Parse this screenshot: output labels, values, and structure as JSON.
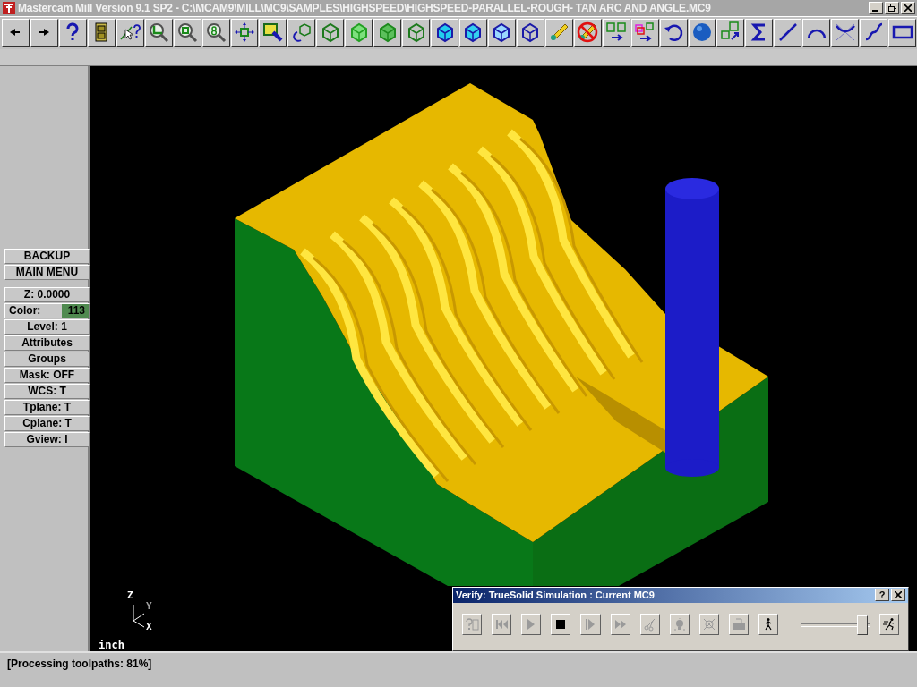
{
  "window": {
    "title": "Mastercam Mill Version 9.1 SP2 - C:\\MCAM9\\MILL\\MC9\\SAMPLES\\HIGHSPEED\\HIGHSPEED-PARALLEL-ROUGH- TAN ARC AND ANGLE.MC9"
  },
  "toolbar": [
    {
      "kind": "left-arrow"
    },
    {
      "kind": "right-arrow"
    },
    {
      "kind": "question-mark"
    },
    {
      "kind": "cabinet"
    },
    {
      "kind": "cursor-question"
    },
    {
      "kind": "magnifier-corner"
    },
    {
      "kind": "magnifier-square"
    },
    {
      "kind": "magnifier-eight"
    },
    {
      "kind": "move-arrows"
    },
    {
      "kind": "paint-brush"
    },
    {
      "kind": "rotate-cube"
    },
    {
      "kind": "wire-cube"
    },
    {
      "kind": "light-cube"
    },
    {
      "kind": "shaded-cube"
    },
    {
      "kind": "hidden-cube"
    },
    {
      "kind": "solid-cube"
    },
    {
      "kind": "face-cube"
    },
    {
      "kind": "side-cube"
    },
    {
      "kind": "outline-cube"
    },
    {
      "kind": "pencil"
    },
    {
      "kind": "no-pencil"
    },
    {
      "kind": "squares-arrow"
    },
    {
      "kind": "colored-squares"
    },
    {
      "kind": "undo-arrow"
    },
    {
      "kind": "sphere"
    },
    {
      "kind": "cubes-arrow"
    },
    {
      "kind": "sigma"
    },
    {
      "kind": "line"
    },
    {
      "kind": "arc"
    },
    {
      "kind": "fillet"
    },
    {
      "kind": "spline"
    },
    {
      "kind": "rectangle"
    }
  ],
  "menu": [
    "BACKUP",
    "MAIN MENU"
  ],
  "settings": [
    {
      "label": "Z:  0.0000"
    },
    {
      "label": "Color:",
      "value": "113",
      "color": "#4f8a4f"
    },
    {
      "label": "Level:  1"
    },
    {
      "label": "Attributes"
    },
    {
      "label": "Groups"
    },
    {
      "label": "Mask:  OFF"
    },
    {
      "label": "WCS:  T"
    },
    {
      "label": "Tplane:  T"
    },
    {
      "label": "Cplane:  T"
    },
    {
      "label": "Gview:  I"
    }
  ],
  "viewport": {
    "axes": {
      "z": "Z",
      "y": "Y",
      "x": "X"
    },
    "units": "inch"
  },
  "verify_dialog": {
    "title": "Verify: TrueSolid Simulation : Current MC9",
    "help": "?",
    "buttons": [
      {
        "kind": "file-help",
        "disabled": true
      },
      {
        "kind": "rewind",
        "disabled": true
      },
      {
        "kind": "play",
        "disabled": true
      },
      {
        "kind": "stop",
        "disabled": false
      },
      {
        "kind": "step",
        "disabled": true
      },
      {
        "kind": "fast-forward",
        "disabled": true
      },
      {
        "kind": "scissors",
        "disabled": true
      },
      {
        "kind": "bulb",
        "disabled": true
      },
      {
        "kind": "crossed-target",
        "disabled": true
      },
      {
        "kind": "keyboard",
        "disabled": true
      },
      {
        "kind": "walker",
        "disabled": false
      }
    ],
    "speed": {
      "level": 0.97
    },
    "end_button": {
      "kind": "runner",
      "disabled": false
    }
  },
  "status_bar": "[Processing toolpaths:  81%]"
}
